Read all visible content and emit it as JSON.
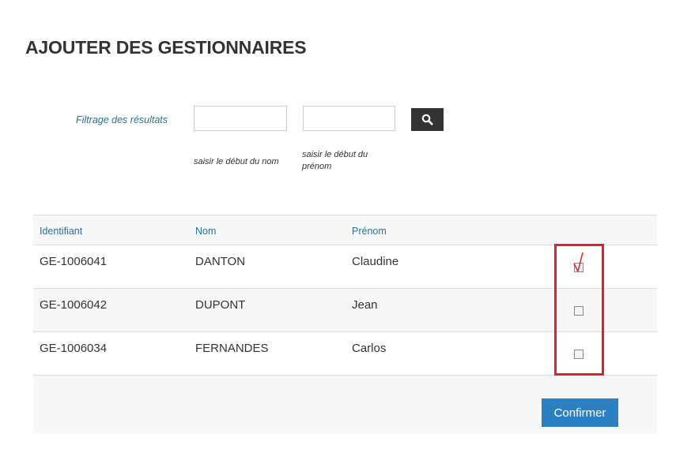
{
  "page": {
    "title": "AJOUTER DES GESTIONNAIRES"
  },
  "filter": {
    "label": "Filtrage des résultats",
    "nom_value": "",
    "prenom_value": "",
    "nom_hint": "saisir le début du nom",
    "prenom_hint": "saisir le début du prénom",
    "search_icon": "search-icon"
  },
  "table": {
    "headers": [
      "Identifiant",
      "Nom",
      "Prénom"
    ],
    "rows": [
      {
        "id": "GE-1006041",
        "nom": "DANTON",
        "prenom": "Claudine",
        "checked": true
      },
      {
        "id": "GE-1006042",
        "nom": "DUPONT",
        "prenom": "Jean",
        "checked": false
      },
      {
        "id": "GE-1006034",
        "nom": "FERNANDES",
        "prenom": "Carlos",
        "checked": false
      }
    ]
  },
  "actions": {
    "confirm_label": "Confirmer"
  },
  "colors": {
    "accent_blue": "#2b80c1",
    "link_blue": "#2a6f97",
    "highlight_red": "#e0202a",
    "search_button": "#333333"
  }
}
